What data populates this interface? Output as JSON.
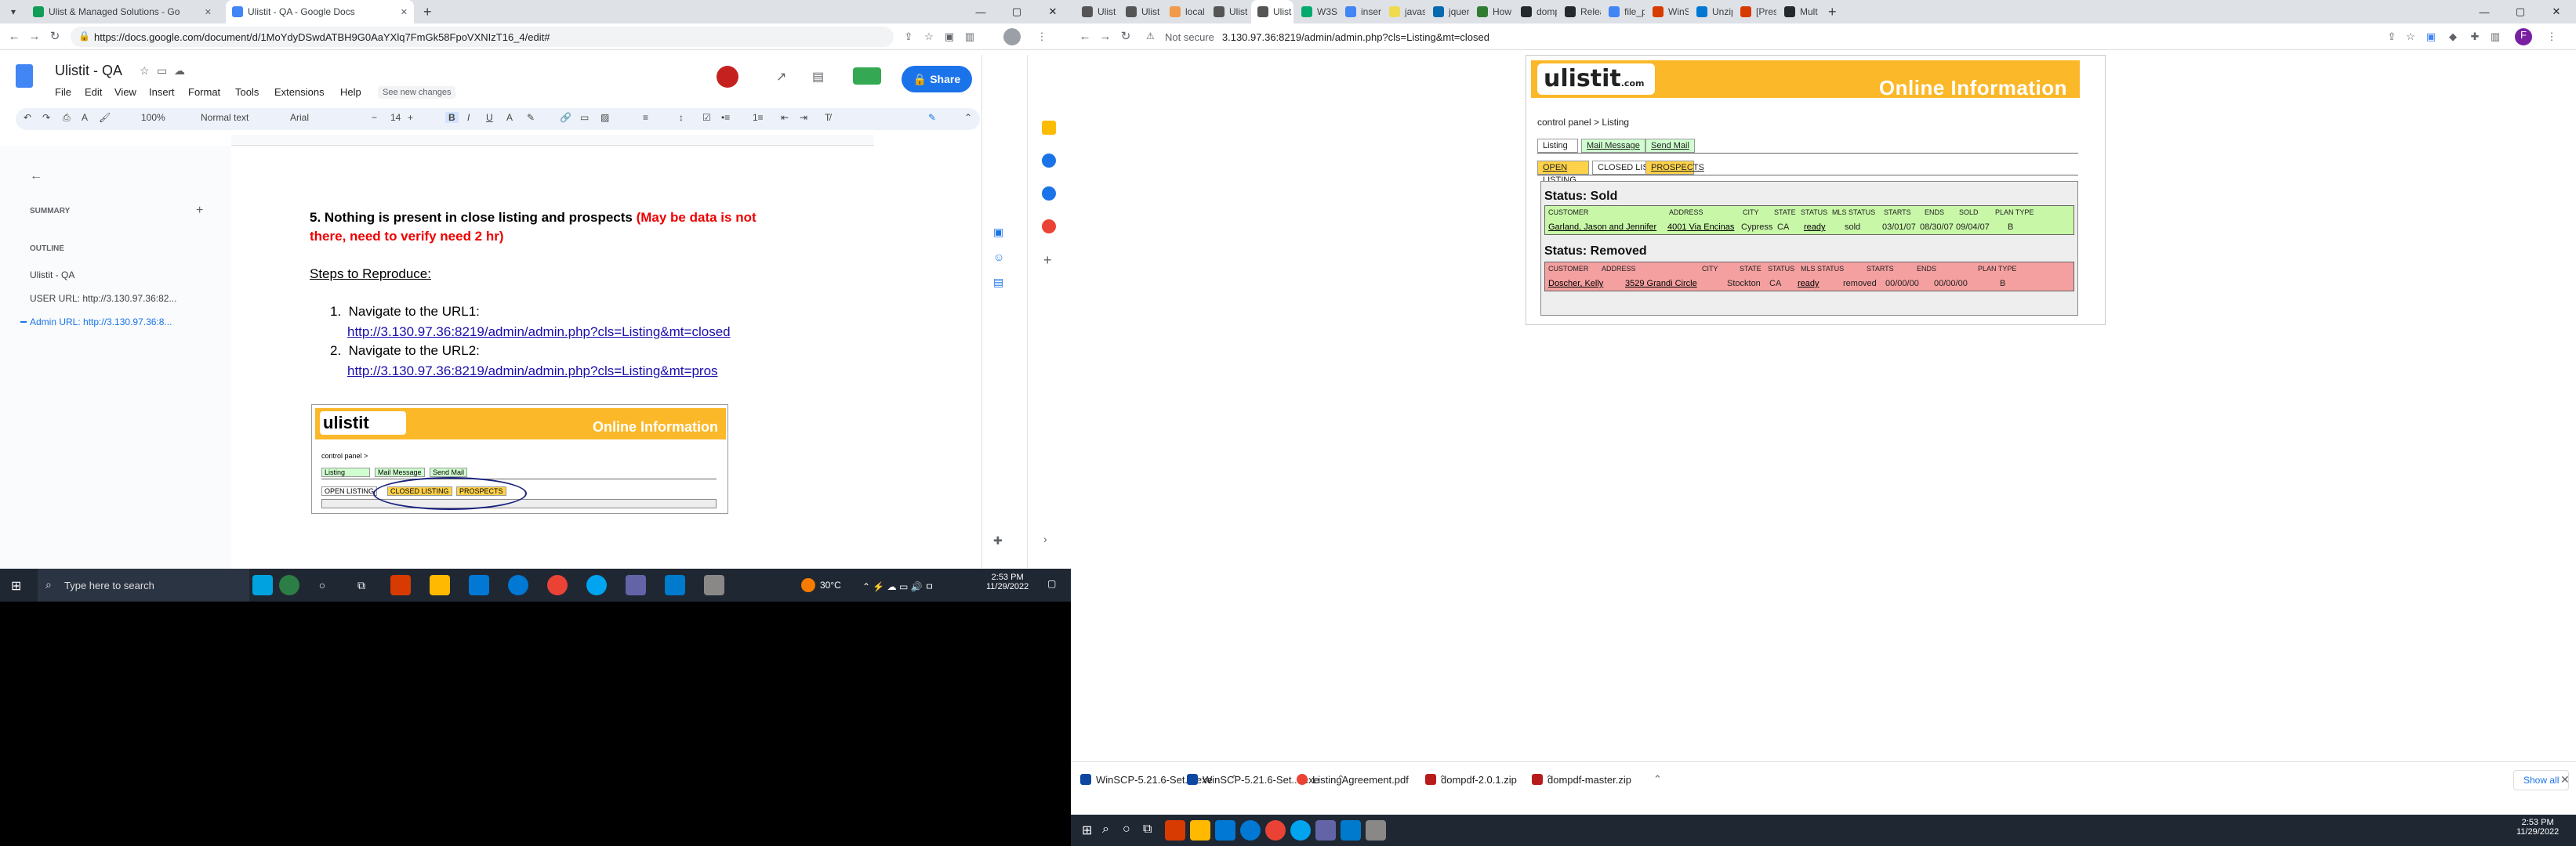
{
  "left": {
    "tabs": [
      {
        "label": "Ulist & Managed Solutions - Go",
        "color": "#0f9d58"
      },
      {
        "label": "Ulistit - QA - Google Docs",
        "color": "#4285f4"
      }
    ],
    "url": "https://docs.google.com/document/d/1MoYdyDSwdATBH9G0AaYXlq7FmGk58FpoVXNIzT16_4/edit#",
    "doc": {
      "title": "Ulistit - QA",
      "menus": [
        "File",
        "Edit",
        "View",
        "Insert",
        "Format",
        "Tools",
        "Extensions",
        "Help"
      ],
      "changes": "See new changes",
      "share": "Share",
      "avatar": "F",
      "zoom": "100%",
      "style": "Normal text",
      "font": "Arial",
      "size": "14"
    },
    "outline": {
      "summary": "SUMMARY",
      "outline": "OUTLINE",
      "items": [
        "Ulistit - QA",
        "USER URL: http://3.130.97.36:82...",
        "Admin URL: http://3.130.97.36:8..."
      ]
    },
    "content": {
      "heading": "5. Nothing is present in close listing and prospects",
      "note": "(May be data is not there, need to verify need 2 hr)",
      "steps": "Steps to Reproduce:",
      "step1": "Navigate to the URL1:",
      "link1": "http://3.130.97.36:8219/admin/admin.php?cls=Listing&mt=closed",
      "step2": "Navigate to the URL2:",
      "link2": "http://3.130.97.36:8219/admin/admin.php?cls=Listing&mt=pros",
      "thumb": {
        "oi": "Online Information",
        "bc": "control panel >",
        "tabs": [
          "Listing",
          "Mail Message",
          "Send Mail"
        ],
        "sub": [
          "OPEN LISTING",
          "CLOSED LISTING",
          "PROSPECTS"
        ]
      }
    },
    "taskbar": {
      "search": "Type here to search",
      "temp": "30°C",
      "time": "2:53 PM",
      "date": "11/29/2022"
    }
  },
  "right": {
    "tabs": [
      "Ulist",
      "Ulist",
      "local",
      "Ulist",
      "Ulist",
      "W3S",
      "insert",
      "javas",
      "jquer",
      "How",
      "domp",
      "Relea",
      "file_p",
      "WinS",
      "Unzip",
      "[Pres",
      "Mult"
    ],
    "url_prefix": "Not secure",
    "url": "3.130.97.36:8219/admin/admin.php?cls=Listing&mt=closed",
    "page": {
      "logo": "ulistit",
      "logo_suffix": ".com",
      "online": "Online Information",
      "breadcrumb": "control panel > Listing",
      "tabs": [
        "Listing",
        "Mail Message",
        "Send Mail"
      ],
      "subtabs": [
        "OPEN LISTING",
        "CLOSED LISTING",
        "PROSPECTS"
      ],
      "sold_title": "Status: Sold",
      "removed_title": "Status: Removed",
      "columns": [
        "CUSTOMER",
        "ADDRESS",
        "CITY",
        "STATE",
        "STATUS",
        "MLS STATUS",
        "STARTS",
        "ENDS",
        "SOLD",
        "PLAN TYPE"
      ],
      "columns_removed": [
        "CUSTOMER",
        "ADDRESS",
        "CITY",
        "STATE",
        "STATUS",
        "MLS STATUS",
        "STARTS",
        "ENDS",
        "PLAN TYPE"
      ],
      "sold_row": [
        "Garland, Jason and Jennifer",
        "4001 Via Encinas",
        "Cypress",
        "CA",
        "ready",
        "sold",
        "03/01/07",
        "08/30/07",
        "09/04/07",
        "B"
      ],
      "removed_row": [
        "Doscher, Kelly",
        "3529 Grandi Circle",
        "Stockton",
        "CA",
        "ready",
        "removed",
        "00/00/00",
        "00/00/00",
        "B"
      ]
    },
    "downloads": [
      "WinSCP-5.21.6-Set....exe",
      "WinSCP-5.21.6-Set....exe",
      "ListingAgreement.pdf",
      "dompdf-2.0.1.zip",
      "dompdf-master.zip"
    ],
    "show_all": "Show all",
    "time": "2:53 PM",
    "date": "11/29/2022"
  }
}
